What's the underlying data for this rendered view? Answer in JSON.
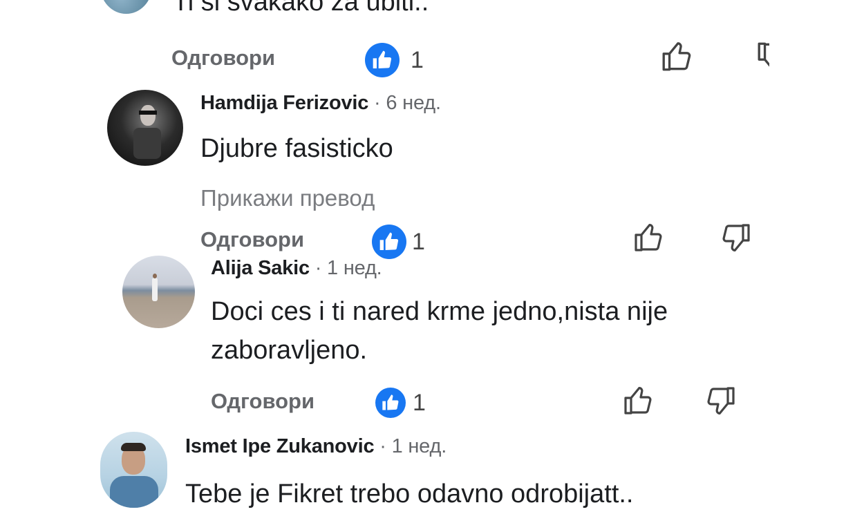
{
  "top_comment": {
    "text": "Ti si svakako za ubiti..",
    "reply_label": "Одговори",
    "likes": "1"
  },
  "comments": [
    {
      "author": "Hamdija Ferizovic",
      "time": " · 6 нед.",
      "text": "Djubre fasisticko",
      "translate_label": "Прикажи превод",
      "reply_label": "Одговори",
      "likes": "1"
    },
    {
      "author": "Alija Sakic",
      "time": " · 1 нед.",
      "text_line1": "Doci ces i ti nared krme jedno,nista nije",
      "text_line2": "zaboravljeno.",
      "reply_label": "Одговори",
      "likes": "1"
    },
    {
      "author": "Ismet Ipe Zukanovic",
      "time": " · 1 нед.",
      "text": "Tebe je Fikret trebo odavno odrobijatt.."
    }
  ],
  "colors": {
    "like_blue": "#1877f2",
    "meta_gray": "#65676b"
  },
  "icons": [
    "thumbs-up-icon",
    "thumbs-down-icon",
    "like-reaction-icon"
  ]
}
